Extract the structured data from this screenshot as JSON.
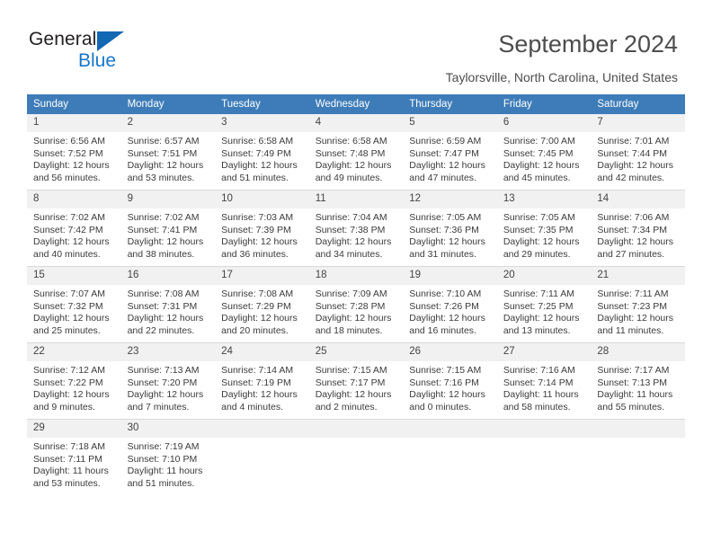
{
  "brand": {
    "name_part1": "General",
    "name_part2": "Blue",
    "triangle_color": "#1268b3",
    "blue_text_color": "#1877c9"
  },
  "header": {
    "title": "September 2024",
    "location": "Taylorsville, North Carolina, United States"
  },
  "calendar": {
    "header_bg": "#3d7cb8",
    "daynum_bg": "#f1f1f1",
    "weekdays": [
      "Sunday",
      "Monday",
      "Tuesday",
      "Wednesday",
      "Thursday",
      "Friday",
      "Saturday"
    ],
    "weeks": [
      [
        {
          "day": "1",
          "sunrise": "Sunrise: 6:56 AM",
          "sunset": "Sunset: 7:52 PM",
          "daylight_line1": "Daylight: 12 hours",
          "daylight_line2": "and 56 minutes."
        },
        {
          "day": "2",
          "sunrise": "Sunrise: 6:57 AM",
          "sunset": "Sunset: 7:51 PM",
          "daylight_line1": "Daylight: 12 hours",
          "daylight_line2": "and 53 minutes."
        },
        {
          "day": "3",
          "sunrise": "Sunrise: 6:58 AM",
          "sunset": "Sunset: 7:49 PM",
          "daylight_line1": "Daylight: 12 hours",
          "daylight_line2": "and 51 minutes."
        },
        {
          "day": "4",
          "sunrise": "Sunrise: 6:58 AM",
          "sunset": "Sunset: 7:48 PM",
          "daylight_line1": "Daylight: 12 hours",
          "daylight_line2": "and 49 minutes."
        },
        {
          "day": "5",
          "sunrise": "Sunrise: 6:59 AM",
          "sunset": "Sunset: 7:47 PM",
          "daylight_line1": "Daylight: 12 hours",
          "daylight_line2": "and 47 minutes."
        },
        {
          "day": "6",
          "sunrise": "Sunrise: 7:00 AM",
          "sunset": "Sunset: 7:45 PM",
          "daylight_line1": "Daylight: 12 hours",
          "daylight_line2": "and 45 minutes."
        },
        {
          "day": "7",
          "sunrise": "Sunrise: 7:01 AM",
          "sunset": "Sunset: 7:44 PM",
          "daylight_line1": "Daylight: 12 hours",
          "daylight_line2": "and 42 minutes."
        }
      ],
      [
        {
          "day": "8",
          "sunrise": "Sunrise: 7:02 AM",
          "sunset": "Sunset: 7:42 PM",
          "daylight_line1": "Daylight: 12 hours",
          "daylight_line2": "and 40 minutes."
        },
        {
          "day": "9",
          "sunrise": "Sunrise: 7:02 AM",
          "sunset": "Sunset: 7:41 PM",
          "daylight_line1": "Daylight: 12 hours",
          "daylight_line2": "and 38 minutes."
        },
        {
          "day": "10",
          "sunrise": "Sunrise: 7:03 AM",
          "sunset": "Sunset: 7:39 PM",
          "daylight_line1": "Daylight: 12 hours",
          "daylight_line2": "and 36 minutes."
        },
        {
          "day": "11",
          "sunrise": "Sunrise: 7:04 AM",
          "sunset": "Sunset: 7:38 PM",
          "daylight_line1": "Daylight: 12 hours",
          "daylight_line2": "and 34 minutes."
        },
        {
          "day": "12",
          "sunrise": "Sunrise: 7:05 AM",
          "sunset": "Sunset: 7:36 PM",
          "daylight_line1": "Daylight: 12 hours",
          "daylight_line2": "and 31 minutes."
        },
        {
          "day": "13",
          "sunrise": "Sunrise: 7:05 AM",
          "sunset": "Sunset: 7:35 PM",
          "daylight_line1": "Daylight: 12 hours",
          "daylight_line2": "and 29 minutes."
        },
        {
          "day": "14",
          "sunrise": "Sunrise: 7:06 AM",
          "sunset": "Sunset: 7:34 PM",
          "daylight_line1": "Daylight: 12 hours",
          "daylight_line2": "and 27 minutes."
        }
      ],
      [
        {
          "day": "15",
          "sunrise": "Sunrise: 7:07 AM",
          "sunset": "Sunset: 7:32 PM",
          "daylight_line1": "Daylight: 12 hours",
          "daylight_line2": "and 25 minutes."
        },
        {
          "day": "16",
          "sunrise": "Sunrise: 7:08 AM",
          "sunset": "Sunset: 7:31 PM",
          "daylight_line1": "Daylight: 12 hours",
          "daylight_line2": "and 22 minutes."
        },
        {
          "day": "17",
          "sunrise": "Sunrise: 7:08 AM",
          "sunset": "Sunset: 7:29 PM",
          "daylight_line1": "Daylight: 12 hours",
          "daylight_line2": "and 20 minutes."
        },
        {
          "day": "18",
          "sunrise": "Sunrise: 7:09 AM",
          "sunset": "Sunset: 7:28 PM",
          "daylight_line1": "Daylight: 12 hours",
          "daylight_line2": "and 18 minutes."
        },
        {
          "day": "19",
          "sunrise": "Sunrise: 7:10 AM",
          "sunset": "Sunset: 7:26 PM",
          "daylight_line1": "Daylight: 12 hours",
          "daylight_line2": "and 16 minutes."
        },
        {
          "day": "20",
          "sunrise": "Sunrise: 7:11 AM",
          "sunset": "Sunset: 7:25 PM",
          "daylight_line1": "Daylight: 12 hours",
          "daylight_line2": "and 13 minutes."
        },
        {
          "day": "21",
          "sunrise": "Sunrise: 7:11 AM",
          "sunset": "Sunset: 7:23 PM",
          "daylight_line1": "Daylight: 12 hours",
          "daylight_line2": "and 11 minutes."
        }
      ],
      [
        {
          "day": "22",
          "sunrise": "Sunrise: 7:12 AM",
          "sunset": "Sunset: 7:22 PM",
          "daylight_line1": "Daylight: 12 hours",
          "daylight_line2": "and 9 minutes."
        },
        {
          "day": "23",
          "sunrise": "Sunrise: 7:13 AM",
          "sunset": "Sunset: 7:20 PM",
          "daylight_line1": "Daylight: 12 hours",
          "daylight_line2": "and 7 minutes."
        },
        {
          "day": "24",
          "sunrise": "Sunrise: 7:14 AM",
          "sunset": "Sunset: 7:19 PM",
          "daylight_line1": "Daylight: 12 hours",
          "daylight_line2": "and 4 minutes."
        },
        {
          "day": "25",
          "sunrise": "Sunrise: 7:15 AM",
          "sunset": "Sunset: 7:17 PM",
          "daylight_line1": "Daylight: 12 hours",
          "daylight_line2": "and 2 minutes."
        },
        {
          "day": "26",
          "sunrise": "Sunrise: 7:15 AM",
          "sunset": "Sunset: 7:16 PM",
          "daylight_line1": "Daylight: 12 hours",
          "daylight_line2": "and 0 minutes."
        },
        {
          "day": "27",
          "sunrise": "Sunrise: 7:16 AM",
          "sunset": "Sunset: 7:14 PM",
          "daylight_line1": "Daylight: 11 hours",
          "daylight_line2": "and 58 minutes."
        },
        {
          "day": "28",
          "sunrise": "Sunrise: 7:17 AM",
          "sunset": "Sunset: 7:13 PM",
          "daylight_line1": "Daylight: 11 hours",
          "daylight_line2": "and 55 minutes."
        }
      ],
      [
        {
          "day": "29",
          "sunrise": "Sunrise: 7:18 AM",
          "sunset": "Sunset: 7:11 PM",
          "daylight_line1": "Daylight: 11 hours",
          "daylight_line2": "and 53 minutes."
        },
        {
          "day": "30",
          "sunrise": "Sunrise: 7:19 AM",
          "sunset": "Sunset: 7:10 PM",
          "daylight_line1": "Daylight: 11 hours",
          "daylight_line2": "and 51 minutes."
        },
        {
          "day": "",
          "sunrise": "",
          "sunset": "",
          "daylight_line1": "",
          "daylight_line2": ""
        },
        {
          "day": "",
          "sunrise": "",
          "sunset": "",
          "daylight_line1": "",
          "daylight_line2": ""
        },
        {
          "day": "",
          "sunrise": "",
          "sunset": "",
          "daylight_line1": "",
          "daylight_line2": ""
        },
        {
          "day": "",
          "sunrise": "",
          "sunset": "",
          "daylight_line1": "",
          "daylight_line2": ""
        },
        {
          "day": "",
          "sunrise": "",
          "sunset": "",
          "daylight_line1": "",
          "daylight_line2": ""
        }
      ]
    ]
  }
}
